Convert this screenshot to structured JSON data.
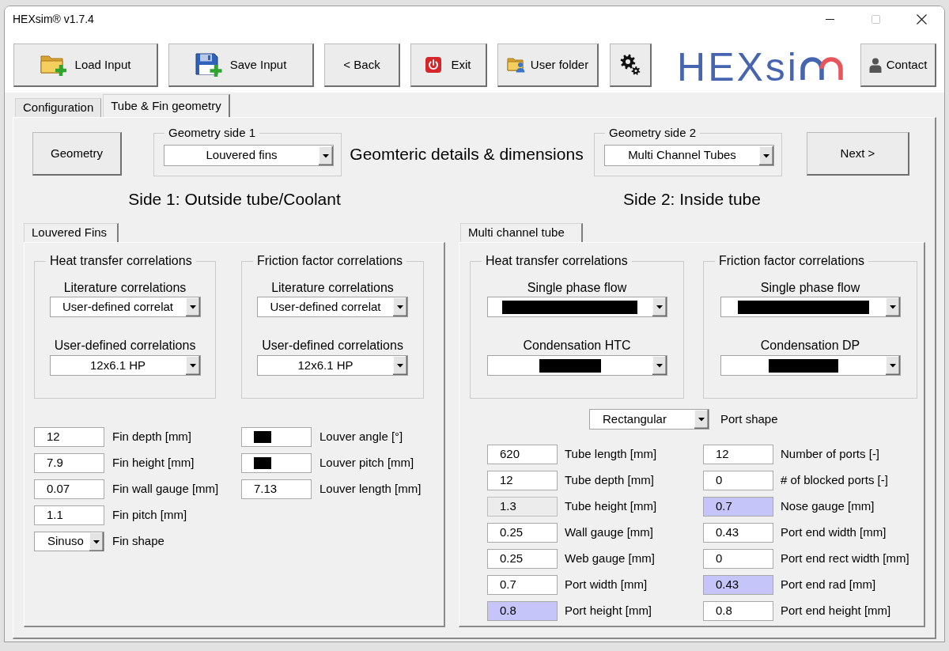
{
  "window": {
    "title": "HEXsim® v1.7.4",
    "maximize_disabled": true
  },
  "toolbar": {
    "load_input": "Load Input",
    "save_input": "Save Input",
    "back": "< Back",
    "exit": "Exit",
    "user_folder": "User folder",
    "contact": "Contact"
  },
  "logo": {
    "text": "HEXsi"
  },
  "tabs": [
    {
      "label": "Configuration",
      "selected": false
    },
    {
      "label": "Tube & Fin geometry",
      "selected": true
    }
  ],
  "geometry_button": "Geometry",
  "geometry_side_1": {
    "legend": "Geometry side 1",
    "value": "Louvered fins"
  },
  "heading": "Geomteric details & dimensions",
  "geometry_side_2": {
    "legend": "Geometry side 2",
    "value": "Multi Channel Tubes"
  },
  "next_button": "Next >",
  "side_1": {
    "heading": "Side 1: Outside tube/Coolant",
    "tab": {
      "label": "Louvered Fins",
      "selected": true
    },
    "groups": [
      {
        "legend": "Heat transfer correlations",
        "dropdowns": [
          {
            "label": "Literature correlations",
            "value": "User-defined correlat",
            "redacted": false
          },
          {
            "label": "User-defined correlations",
            "value": "12x6.1 HP",
            "redacted": false
          }
        ]
      },
      {
        "legend": "Friction factor correlations",
        "dropdowns": [
          {
            "label": "Literature correlations",
            "value": "User-defined correlat",
            "redacted": false
          },
          {
            "label": "User-defined correlations",
            "value": "12x6.1 HP",
            "redacted": false
          }
        ]
      }
    ],
    "field_columns": [
      [
        {
          "kind": "input",
          "label": "Fin depth [mm]",
          "value": "12",
          "redacted": false
        },
        {
          "kind": "input",
          "label": "Fin height [mm]",
          "value": "7.9",
          "redacted": false
        },
        {
          "kind": "input",
          "label": "Fin wall gauge [mm]",
          "value": "0.07",
          "redacted": false
        },
        {
          "kind": "input",
          "label": "Fin pitch [mm]",
          "value": "1.1",
          "redacted": false
        },
        {
          "kind": "dropdown",
          "label": "Fin shape",
          "value": "Sinuso",
          "redacted": false
        }
      ],
      [
        {
          "kind": "input",
          "label": "Louver angle [°]",
          "redacted": true
        },
        {
          "kind": "input",
          "label": "Louver pitch [mm]",
          "redacted": true
        },
        {
          "kind": "input",
          "label": "Louver length [mm]",
          "value": "7.13",
          "redacted": false
        }
      ]
    ]
  },
  "side_2": {
    "heading": "Side 2: Inside tube",
    "tab": {
      "label": "Multi channel tube",
      "selected": true
    },
    "groups": [
      {
        "legend": "Heat transfer correlations",
        "dropdowns": [
          {
            "label": "Single phase flow",
            "redacted": true
          },
          {
            "label": "Condensation HTC",
            "redacted": true
          }
        ]
      },
      {
        "legend": "Friction factor correlations",
        "dropdowns": [
          {
            "label": "Single phase flow",
            "redacted": true
          },
          {
            "label": "Condensation DP",
            "redacted": true
          }
        ]
      }
    ],
    "port_shape": {
      "label": "Port shape",
      "value": "Rectangular"
    },
    "field_columns": [
      [
        {
          "label": "Tube length [mm]",
          "value": "620",
          "highlighted": false,
          "readonly": false
        },
        {
          "label": "Tube depth [mm]",
          "value": "12",
          "highlighted": false,
          "readonly": false
        },
        {
          "label": "Tube height [mm]",
          "value": "1.3",
          "highlighted": false,
          "readonly": true
        },
        {
          "label": "Wall gauge [mm]",
          "value": "0.25",
          "highlighted": false,
          "readonly": false
        },
        {
          "label": "Web gauge [mm]",
          "value": "0.25",
          "highlighted": false,
          "readonly": false
        },
        {
          "label": "Port width [mm]",
          "value": "0.7",
          "highlighted": false,
          "readonly": false
        },
        {
          "label": "Port height [mm]",
          "value": "0.8",
          "highlighted": true,
          "readonly": false
        }
      ],
      [
        {
          "label": "Number of ports [-]",
          "value": "12",
          "highlighted": false,
          "readonly": false
        },
        {
          "label": "# of blocked ports [-]",
          "value": "0",
          "highlighted": false,
          "readonly": false
        },
        {
          "label": "Nose gauge [mm]",
          "value": "0.7",
          "highlighted": true,
          "readonly": false
        },
        {
          "label": "Port end width [mm]",
          "value": "0.43",
          "highlighted": false,
          "readonly": false
        },
        {
          "label": "Port end rect width [mm]",
          "value": "0",
          "highlighted": false,
          "readonly": false
        },
        {
          "label": "Port end rad [mm]",
          "value": "0.43",
          "highlighted": true,
          "readonly": false
        },
        {
          "label": "Port end height [mm]",
          "value": "0.8",
          "highlighted": false,
          "readonly": false
        }
      ]
    ]
  }
}
